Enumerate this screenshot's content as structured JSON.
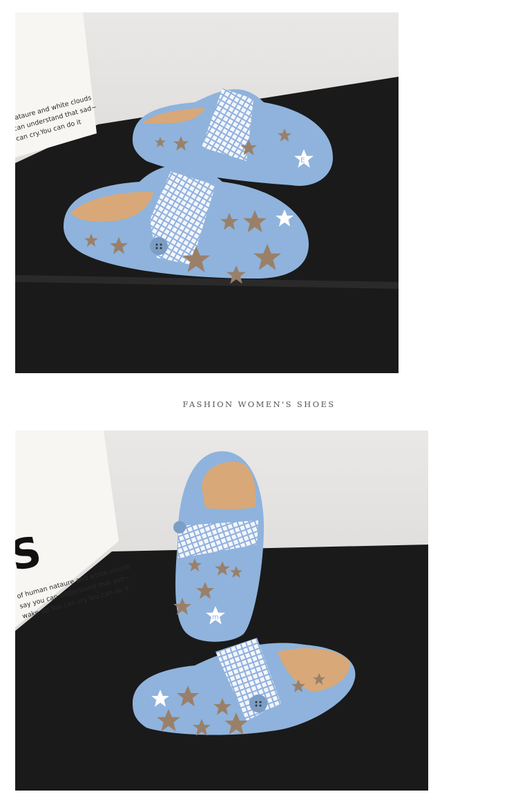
{
  "caption": "FASHION WOMEN'S SHOES",
  "photo1": {
    "bag_text": [
      "nataure and white clouds",
      "can understand that sad~",
      "can cry.You can do it"
    ]
  },
  "photo2": {
    "bag_text": [
      "of human nataure and white clouds",
      "say you can understand that sad~",
      "wake up.You can cry.You can do it"
    ]
  },
  "colors": {
    "shoe_blue": "#8fb3dc",
    "star_brown": "#9a8069",
    "table_black": "#1a1a1a",
    "insole_tan": "#d9a878"
  },
  "star_letters": [
    "E",
    "m"
  ]
}
